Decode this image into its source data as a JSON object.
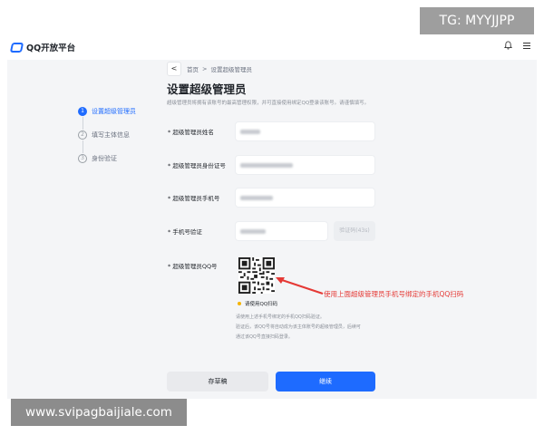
{
  "watermark_tg": "TG: MYYJJPP",
  "watermark_url": "www.svipagbaijiale.com",
  "app": {
    "logo_text": "QQ开放平台"
  },
  "breadcrumb": {
    "back": "<",
    "home": "首页",
    "sep": ">",
    "current": "设置超级管理员"
  },
  "page": {
    "title": "设置超级管理员",
    "description": "超级管理员将拥有该账号的最高管理权限，并可直接使用绑定QQ登录该账号。请谨慎填写。"
  },
  "steps": [
    {
      "num": "1",
      "label": "设置超级管理员",
      "active": true
    },
    {
      "num": "2",
      "label": "填写主体信息",
      "active": false
    },
    {
      "num": "3",
      "label": "身份验证",
      "active": false
    }
  ],
  "form": {
    "name_label": "超级管理员姓名",
    "id_label": "超级管理员身份证号",
    "phone_label": "超级管理员手机号",
    "code_label": "手机号验证",
    "code_button": "验证码(43s)",
    "qq_label": "超级管理员QQ号"
  },
  "qr": {
    "hint": "请使用QQ扫码",
    "note_1": "请使用上述手机号绑定的手机QQ扫码验证。",
    "note_2": "验证后，该QQ号将自动成为该主体账号的超级管理员，后续可",
    "note_3": "通过该QQ号直接扫码登录。"
  },
  "annotation": "使用上面超级管理员手机号绑定的手机QQ扫码",
  "buttons": {
    "draft": "存草稿",
    "next": "继续"
  },
  "colors": {
    "primary": "#1e6bff",
    "annotation": "#e53935",
    "badge": "#f5b400"
  }
}
